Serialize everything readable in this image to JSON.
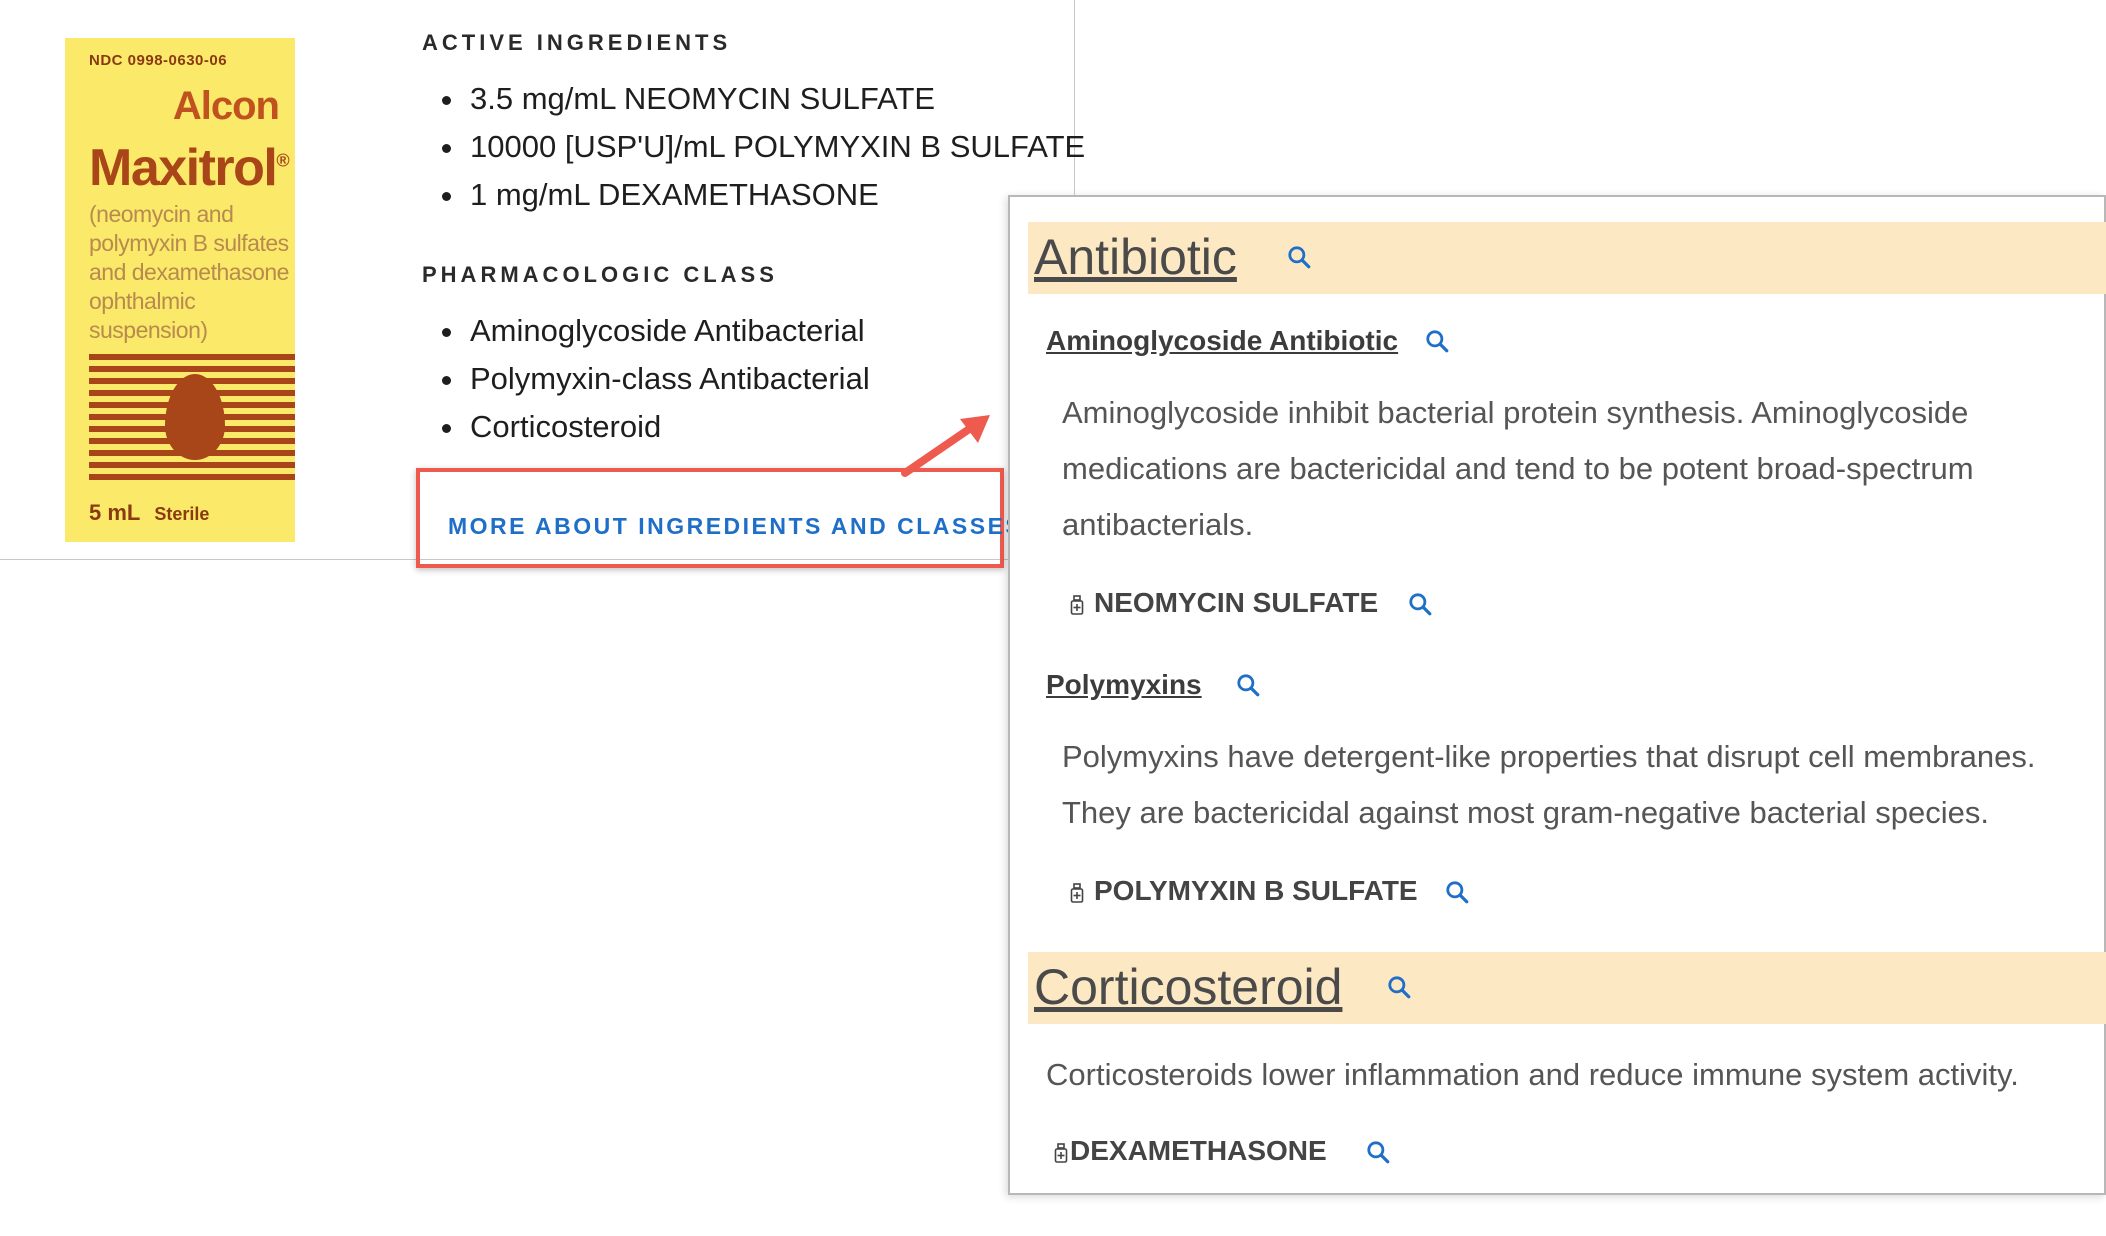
{
  "product_image": {
    "ndc": "NDC 0998-0630-06",
    "brand": "Alcon",
    "name": "Maxitrol",
    "registered_mark": "®",
    "description": "(neomycin and polymyxin B sulfates and dexamethasone ophthalmic suspension)",
    "volume": "5 mL",
    "sterile": "Sterile"
  },
  "active_ingredients": {
    "heading": "ACTIVE INGREDIENTS",
    "items": [
      "3.5 mg/mL NEOMYCIN SULFATE",
      "10000 [USP'U]/mL POLYMYXIN B SULFATE",
      "1 mg/mL DEXAMETHASONE"
    ]
  },
  "pharmacologic_class": {
    "heading": "PHARMACOLOGIC CLASS",
    "items": [
      "Aminoglycoside Antibacterial",
      "Polymyxin-class Antibacterial",
      "Corticosteroid"
    ]
  },
  "more_link": "MORE ABOUT INGREDIENTS AND CLASSES",
  "panel": {
    "antibiotic": {
      "title": "Antibiotic",
      "aminoglycoside": {
        "title": "Aminoglycoside Antibiotic",
        "desc_lines": [
          "Aminoglycoside inhibit bacterial protein synthesis. Aminoglycoside",
          "medications are bactericidal and tend to be potent broad-spectrum",
          "antibacterials."
        ],
        "ingredient": "NEOMYCIN SULFATE"
      },
      "polymyxins": {
        "title": "Polymyxins",
        "desc_lines": [
          "Polymyxins have detergent-like properties that disrupt cell membranes.",
          "They are bactericidal against most gram-negative bacterial species."
        ],
        "ingredient": "POLYMYXIN B SULFATE"
      }
    },
    "corticosteroid": {
      "title": "Corticosteroid",
      "desc": "Corticosteroids lower inflammation and reduce immune system activity.",
      "ingredient": "DEXAMETHASONE"
    }
  },
  "colors": {
    "link_blue": "#1f6fc8",
    "highlight_red": "#ef5a4e",
    "category_bg": "#fde8c4",
    "box_yellow": "#fbe96a"
  },
  "icons": {
    "search": "search-icon",
    "bottle": "medicine-bottle-icon"
  }
}
